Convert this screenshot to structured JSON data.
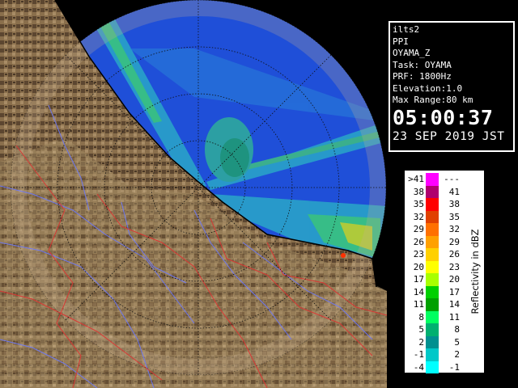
{
  "info": {
    "radar_name": "ilts2",
    "product": "PPI",
    "site": "OYAMA_Z",
    "task": "Task: OYAMA",
    "prf": "PRF: 1800Hz",
    "elevation": "Elevation:1.0",
    "max_range": "Max Range:80 km",
    "time": "05:00:37",
    "date": "23 SEP 2019 JST"
  },
  "legend": {
    "title": "Reflectivity in dBZ",
    "rows": [
      {
        "low": ">41",
        "high": "---",
        "color": "#ff00ff"
      },
      {
        "low": "38",
        "high": "41",
        "color": "#b0006e"
      },
      {
        "low": "35",
        "high": "38",
        "color": "#ff0000"
      },
      {
        "low": "32",
        "high": "35",
        "color": "#e04000"
      },
      {
        "low": "29",
        "high": "32",
        "color": "#ff7000"
      },
      {
        "low": "26",
        "high": "29",
        "color": "#ffa000"
      },
      {
        "low": "23",
        "high": "26",
        "color": "#ffd000"
      },
      {
        "low": "20",
        "high": "23",
        "color": "#ffff00"
      },
      {
        "low": "17",
        "high": "20",
        "color": "#a8ff00"
      },
      {
        "low": "14",
        "high": "17",
        "color": "#00d000"
      },
      {
        "low": "11",
        "high": "14",
        "color": "#00a000"
      },
      {
        "low": "8",
        "high": "11",
        "color": "#00ff60"
      },
      {
        "low": "5",
        "high": "8",
        "color": "#00b070"
      },
      {
        "low": "2",
        "high": "5",
        "color": "#009090"
      },
      {
        "low": "-1",
        "high": "2",
        "color": "#00c8c8"
      },
      {
        "low": "-4",
        "high": "-1",
        "color": "#00ffff"
      }
    ]
  },
  "colors": {
    "echo_background": "#1f4fd8",
    "land": "#7a6040",
    "range_ring": "#101010"
  }
}
